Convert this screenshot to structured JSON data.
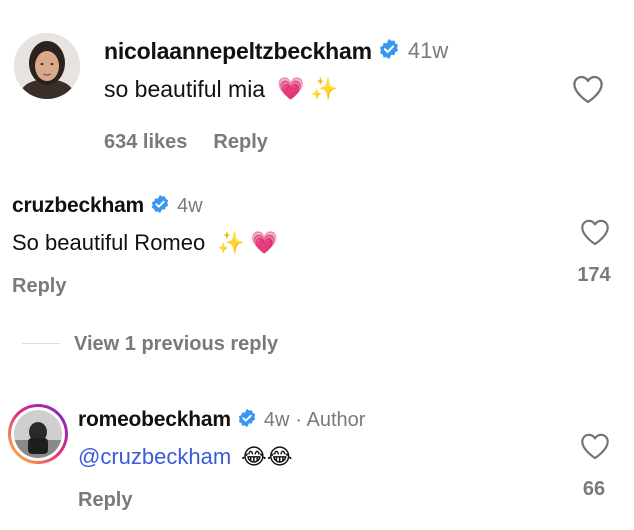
{
  "comments": [
    {
      "username": "nicolaannepeltzbeckham",
      "time": "41w",
      "text": "so beautiful mia",
      "emoji": "💗 ✨",
      "likes_label": "634 likes",
      "reply_label": "Reply"
    },
    {
      "username": "cruzbeckham",
      "time": "4w",
      "text": "So beautiful Romeo",
      "emoji": "✨ 💗",
      "reply_label": "Reply",
      "like_count": "174"
    },
    {
      "username": "romeobeckham",
      "time": "4w",
      "author_tag": "· Author",
      "mention": "@cruzbeckham",
      "emoji": "😂😂",
      "reply_label": "Reply",
      "like_count": "66"
    }
  ],
  "view_previous_label": "View 1 previous reply",
  "colors": {
    "verified": "#3897f0",
    "mention": "#3b5bdb",
    "muted": "#7a7a7a"
  }
}
